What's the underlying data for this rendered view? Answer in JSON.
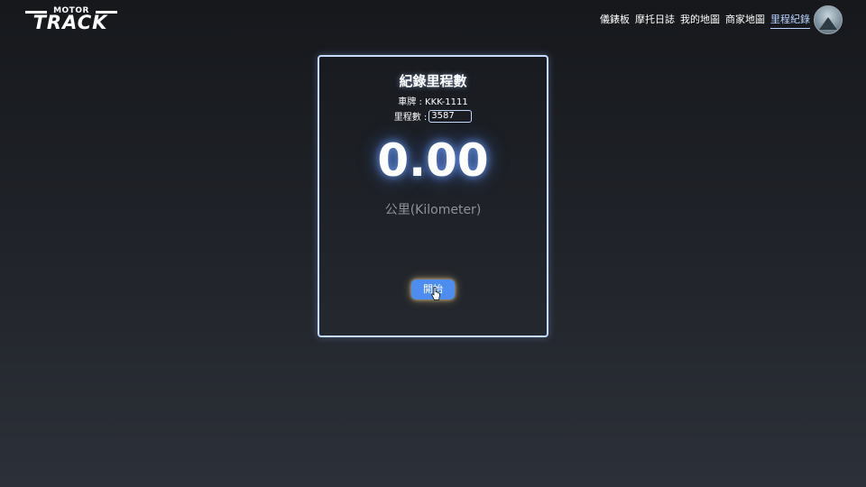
{
  "header": {
    "logo_top": "MOTOR",
    "logo_main": "TRACK",
    "nav": [
      {
        "label": "儀錶板",
        "active": false
      },
      {
        "label": "摩托日誌",
        "active": false
      },
      {
        "label": "我的地圖",
        "active": false
      },
      {
        "label": "商家地圖",
        "active": false
      },
      {
        "label": "里程紀錄",
        "active": true
      }
    ],
    "avatar_icon": "user-avatar"
  },
  "card": {
    "title": "紀錄里程數",
    "plate_text": "車牌 : KKK-1111",
    "mileage_label": "里程數 :",
    "mileage_value": "3587",
    "distance": "0.00",
    "unit": "公里(Kilometer)",
    "start_label": "開始"
  },
  "colors": {
    "accent": "#4d8df0",
    "active_nav": "#b8d4ff",
    "card_border": "#c4dbff",
    "unit_text": "#8d929a"
  }
}
